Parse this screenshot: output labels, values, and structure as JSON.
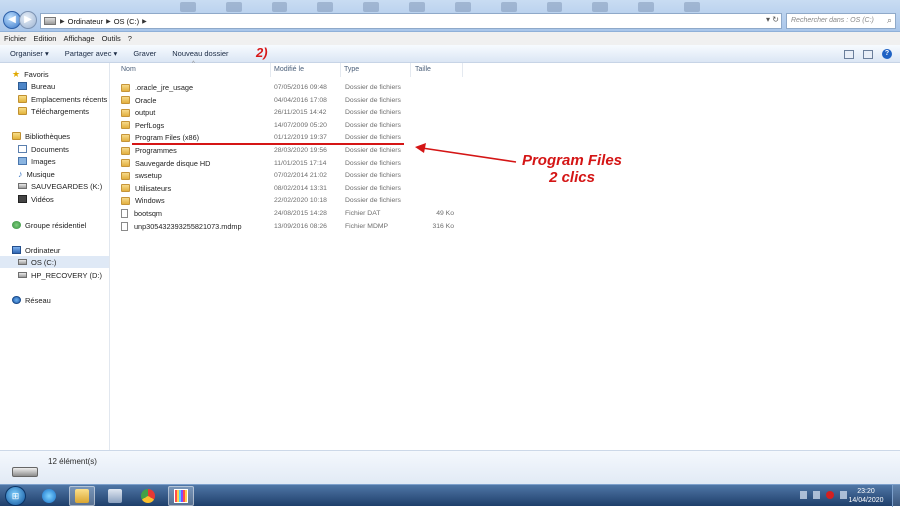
{
  "address": {
    "crumbs": [
      "Ordinateur",
      "OS (C:)"
    ],
    "search_placeholder": "Rechercher dans : OS (C:)"
  },
  "menu": [
    "Fichier",
    "Edition",
    "Affichage",
    "Outils",
    "?"
  ],
  "toolbar": {
    "organize": "Organiser ▾",
    "share": "Partager avec ▾",
    "burn": "Graver",
    "new_folder": "Nouveau dossier"
  },
  "annotations": {
    "step": "2)",
    "main_line1": "Program Files",
    "main_line2": "2 clics",
    "color": "#d41515"
  },
  "nav": {
    "favorites": "Favoris",
    "desktop": "Bureau",
    "recent": "Emplacements récents",
    "downloads": "Téléchargements",
    "libraries": "Bibliothèques",
    "documents": "Documents",
    "images": "Images",
    "music": "Musique",
    "backups": "SAUVEGARDES (K:)",
    "videos": "Vidéos",
    "homegroup": "Groupe résidentiel",
    "computer": "Ordinateur",
    "os_drive": "OS (C:)",
    "recovery": "HP_RECOVERY (D:)",
    "network": "Réseau"
  },
  "columns": {
    "name": "Nom",
    "modified": "Modifié le",
    "type": "Type",
    "size": "Taille"
  },
  "files": [
    {
      "name": ".oracle_jre_usage",
      "date": "07/05/2016 09:48",
      "type": "Dossier de fichiers",
      "size": "",
      "kind": "folder"
    },
    {
      "name": "Oracle",
      "date": "04/04/2016 17:08",
      "type": "Dossier de fichiers",
      "size": "",
      "kind": "folder"
    },
    {
      "name": "output",
      "date": "26/11/2015 14:42",
      "type": "Dossier de fichiers",
      "size": "",
      "kind": "folder"
    },
    {
      "name": "PerfLogs",
      "date": "14/07/2009 05:20",
      "type": "Dossier de fichiers",
      "size": "",
      "kind": "folder"
    },
    {
      "name": "Program Files (x86)",
      "date": "01/12/2019 19:37",
      "type": "Dossier de fichiers",
      "size": "",
      "kind": "folder"
    },
    {
      "name": "Programmes",
      "date": "28/03/2020 19:56",
      "type": "Dossier de fichiers",
      "size": "",
      "kind": "folder"
    },
    {
      "name": "Sauvegarde disque HD",
      "date": "11/01/2015 17:14",
      "type": "Dossier de fichiers",
      "size": "",
      "kind": "folder"
    },
    {
      "name": "swsetup",
      "date": "07/02/2014 21:02",
      "type": "Dossier de fichiers",
      "size": "",
      "kind": "folder"
    },
    {
      "name": "Utilisateurs",
      "date": "08/02/2014 13:31",
      "type": "Dossier de fichiers",
      "size": "",
      "kind": "folder"
    },
    {
      "name": "Windows",
      "date": "22/02/2020 10:18",
      "type": "Dossier de fichiers",
      "size": "",
      "kind": "folder"
    },
    {
      "name": "bootsqm",
      "date": "24/08/2015 14:28",
      "type": "Fichier DAT",
      "size": "49 Ko",
      "kind": "file"
    },
    {
      "name": "unp305432393255821073.mdmp",
      "date": "13/09/2016 08:26",
      "type": "Fichier MDMP",
      "size": "316 Ko",
      "kind": "file"
    }
  ],
  "status": {
    "count": "12 élément(s)"
  },
  "clock": {
    "time": "23:20",
    "date": "14/04/2020"
  }
}
